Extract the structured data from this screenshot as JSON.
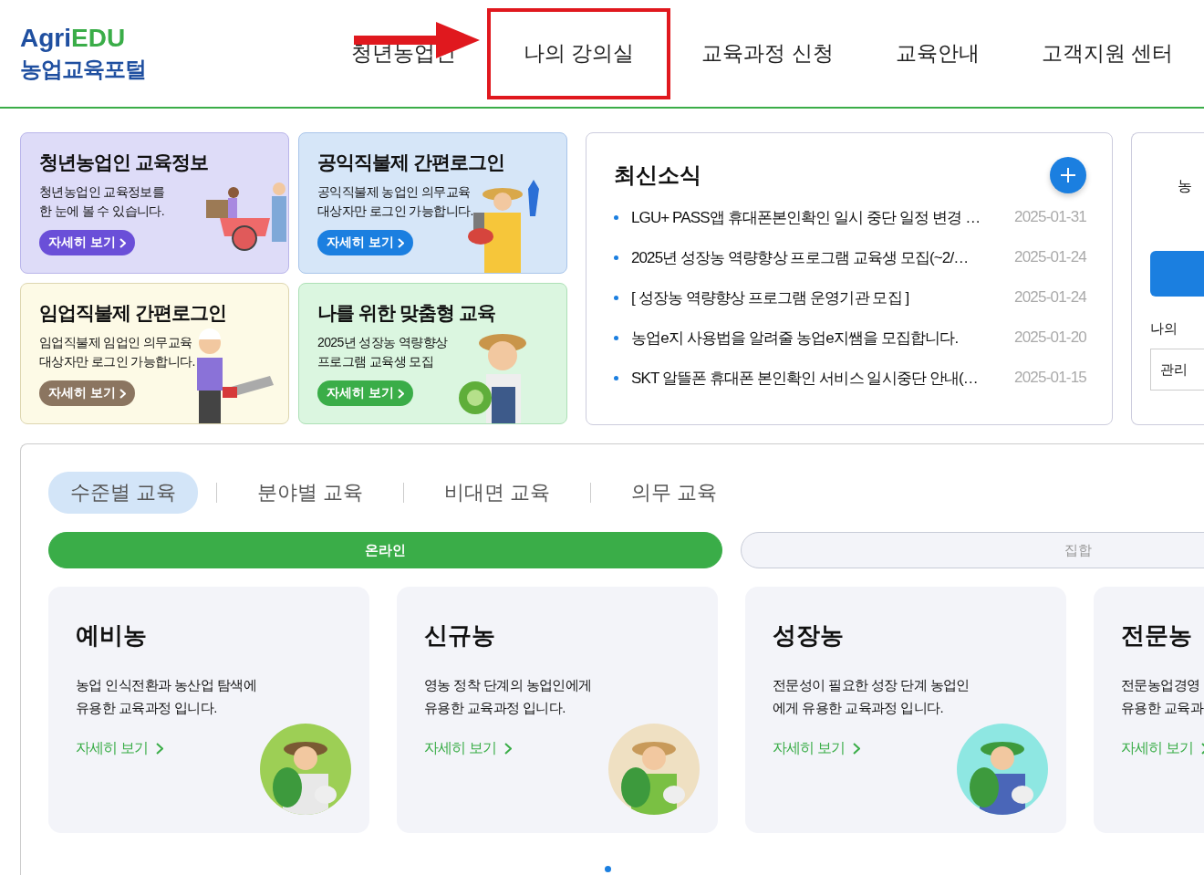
{
  "header": {
    "logo": {
      "brand_a": "Agri",
      "brand_b": "EDU",
      "subtitle": "농업교육포털"
    },
    "nav": [
      {
        "label": "청년농업인",
        "highlighted": false
      },
      {
        "label": "나의 강의실",
        "highlighted": true
      },
      {
        "label": "교육과정 신청",
        "highlighted": false
      },
      {
        "label": "교육안내",
        "highlighted": false
      },
      {
        "label": "고객지원 센터",
        "highlighted": false
      }
    ]
  },
  "banners": [
    {
      "kind": "youth",
      "title": "청년농업인 교육정보",
      "lines": [
        "청년농업인 교육정보를",
        "한 눈에 볼 수 있습니다."
      ],
      "button": "자세히 보기",
      "color": "#6a4fd8"
    },
    {
      "kind": "public",
      "title": "공익직불제 간편로그인",
      "lines": [
        "공익직불제 농업인 의무교육",
        "대상자만 로그인 가능합니다."
      ],
      "button": "자세히 보기",
      "color": "#1b7fe0"
    },
    {
      "kind": "forest",
      "title": "임업직불제 간편로그인",
      "lines": [
        "임업직불제 임업인 의무교육",
        "대상자만 로그인 가능합니다."
      ],
      "button": "자세히 보기",
      "color": "#8b7560"
    },
    {
      "kind": "custom",
      "title": "나를 위한 맞춤형 교육",
      "lines": [
        "2025년 성장농 역량향상",
        "프로그램 교육생 모집"
      ],
      "button": "자세히 보기",
      "color": "#3aad48"
    }
  ],
  "news": {
    "title": "최신소식",
    "items": [
      {
        "text": "LGU+ PASS앱 휴대폰본인확인 일시 중단 일정 변경 …",
        "date": "2025-01-31"
      },
      {
        "text": "2025년 성장농 역량향상 프로그램 교육생 모집(~2/…",
        "date": "2025-01-24"
      },
      {
        "text": "[ 성장농 역량향상 프로그램 운영기관 모집 ]",
        "date": "2025-01-24"
      },
      {
        "text": "농업e지 사용법을 알려줄 농업e지쌤을 모집합니다.",
        "date": "2025-01-20"
      },
      {
        "text": "SKT 알뜰폰 휴대폰 본인확인 서비스 일시중단 안내(…",
        "date": "2025-01-15"
      }
    ]
  },
  "side_panel": {
    "line": "농",
    "label": "나의",
    "field": "관리"
  },
  "education": {
    "tabs": [
      {
        "label": "수준별 교육",
        "selected": true
      },
      {
        "label": "분야별 교육",
        "selected": false
      },
      {
        "label": "비대면 교육",
        "selected": false
      },
      {
        "label": "의무 교육",
        "selected": false
      }
    ],
    "modes": [
      {
        "label": "온라인",
        "selected": true
      },
      {
        "label": "집합",
        "selected": false
      }
    ],
    "courses": [
      {
        "kind": "pre",
        "title": "예비농",
        "lines": [
          "농업 인식전환과 농산업 탐색에",
          "유용한 교육과정 입니다."
        ],
        "link": "자세히 보기"
      },
      {
        "kind": "new",
        "title": "신규농",
        "lines": [
          "영농 정착 단계의 농업인에게",
          "유용한 교육과정 입니다."
        ],
        "link": "자세히 보기"
      },
      {
        "kind": "growth",
        "title": "성장농",
        "lines": [
          "전문성이 필요한 성장 단계 농업인",
          "에게 유용한 교육과정 입니다."
        ],
        "link": "자세히 보기"
      },
      {
        "title": "전문농",
        "lines": [
          "전문농업경영",
          "유용한 교육과"
        ],
        "link": "자세히 보기"
      }
    ],
    "pager": [
      {
        "selected": true
      }
    ]
  }
}
